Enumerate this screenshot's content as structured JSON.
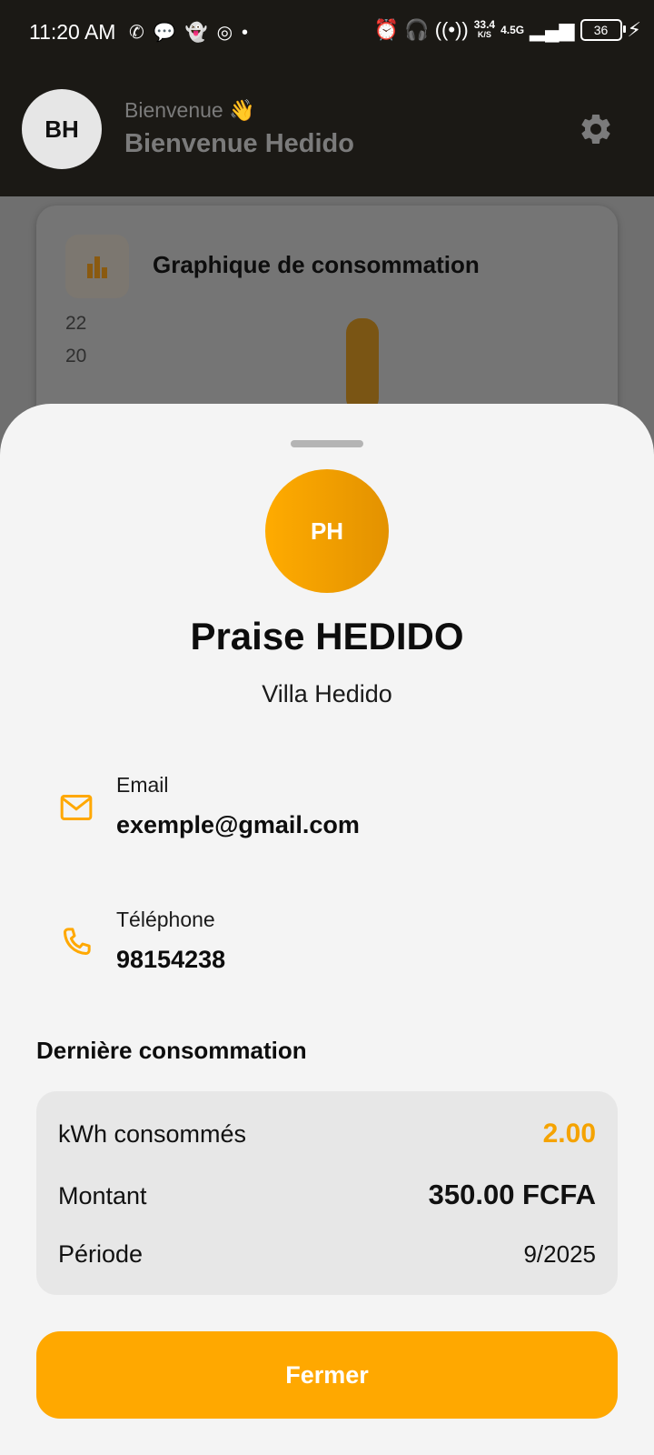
{
  "status_bar": {
    "time": "11:20 AM",
    "left_icons": [
      "whatsapp-icon",
      "chat-icon",
      "snapchat-icon",
      "app-icon",
      "dot-icon"
    ],
    "net_speed_value": "33.4",
    "net_speed_unit": "K/S",
    "network": "4.5G",
    "battery": "36"
  },
  "header": {
    "avatar_initials": "BH",
    "greeting_small": "Bienvenue 👋",
    "greeting_big": "Bienvenue Hedido",
    "settings_icon": "gear-icon"
  },
  "chart_card": {
    "title": "Graphique de consommation",
    "icon": "bar-chart-icon"
  },
  "chart_data": {
    "type": "bar",
    "title": "Graphique de consommation",
    "y_ticks_visible": [
      "22",
      "20"
    ],
    "values_visible": [
      22
    ],
    "bar_color": "#7a5514"
  },
  "profile": {
    "avatar_initials": "PH",
    "name": "Praise HEDIDO",
    "location": "Villa Hedido",
    "email_label": "Email",
    "email_value": "exemple@gmail.com",
    "phone_label": "Téléphone",
    "phone_value": "98154238"
  },
  "last_consumption": {
    "title": "Dernière consommation",
    "kwh_label": "kWh consommés",
    "kwh_value": "2.00",
    "amount_label": "Montant",
    "amount_value": "350.00 FCFA",
    "period_label": "Période",
    "period_value": "9/2025"
  },
  "actions": {
    "close_label": "Fermer"
  },
  "colors": {
    "accent": "#ffa800",
    "header_bg": "#1b1915",
    "sheet_bg": "#f4f4f4",
    "card_bg": "#e7e7e7"
  }
}
